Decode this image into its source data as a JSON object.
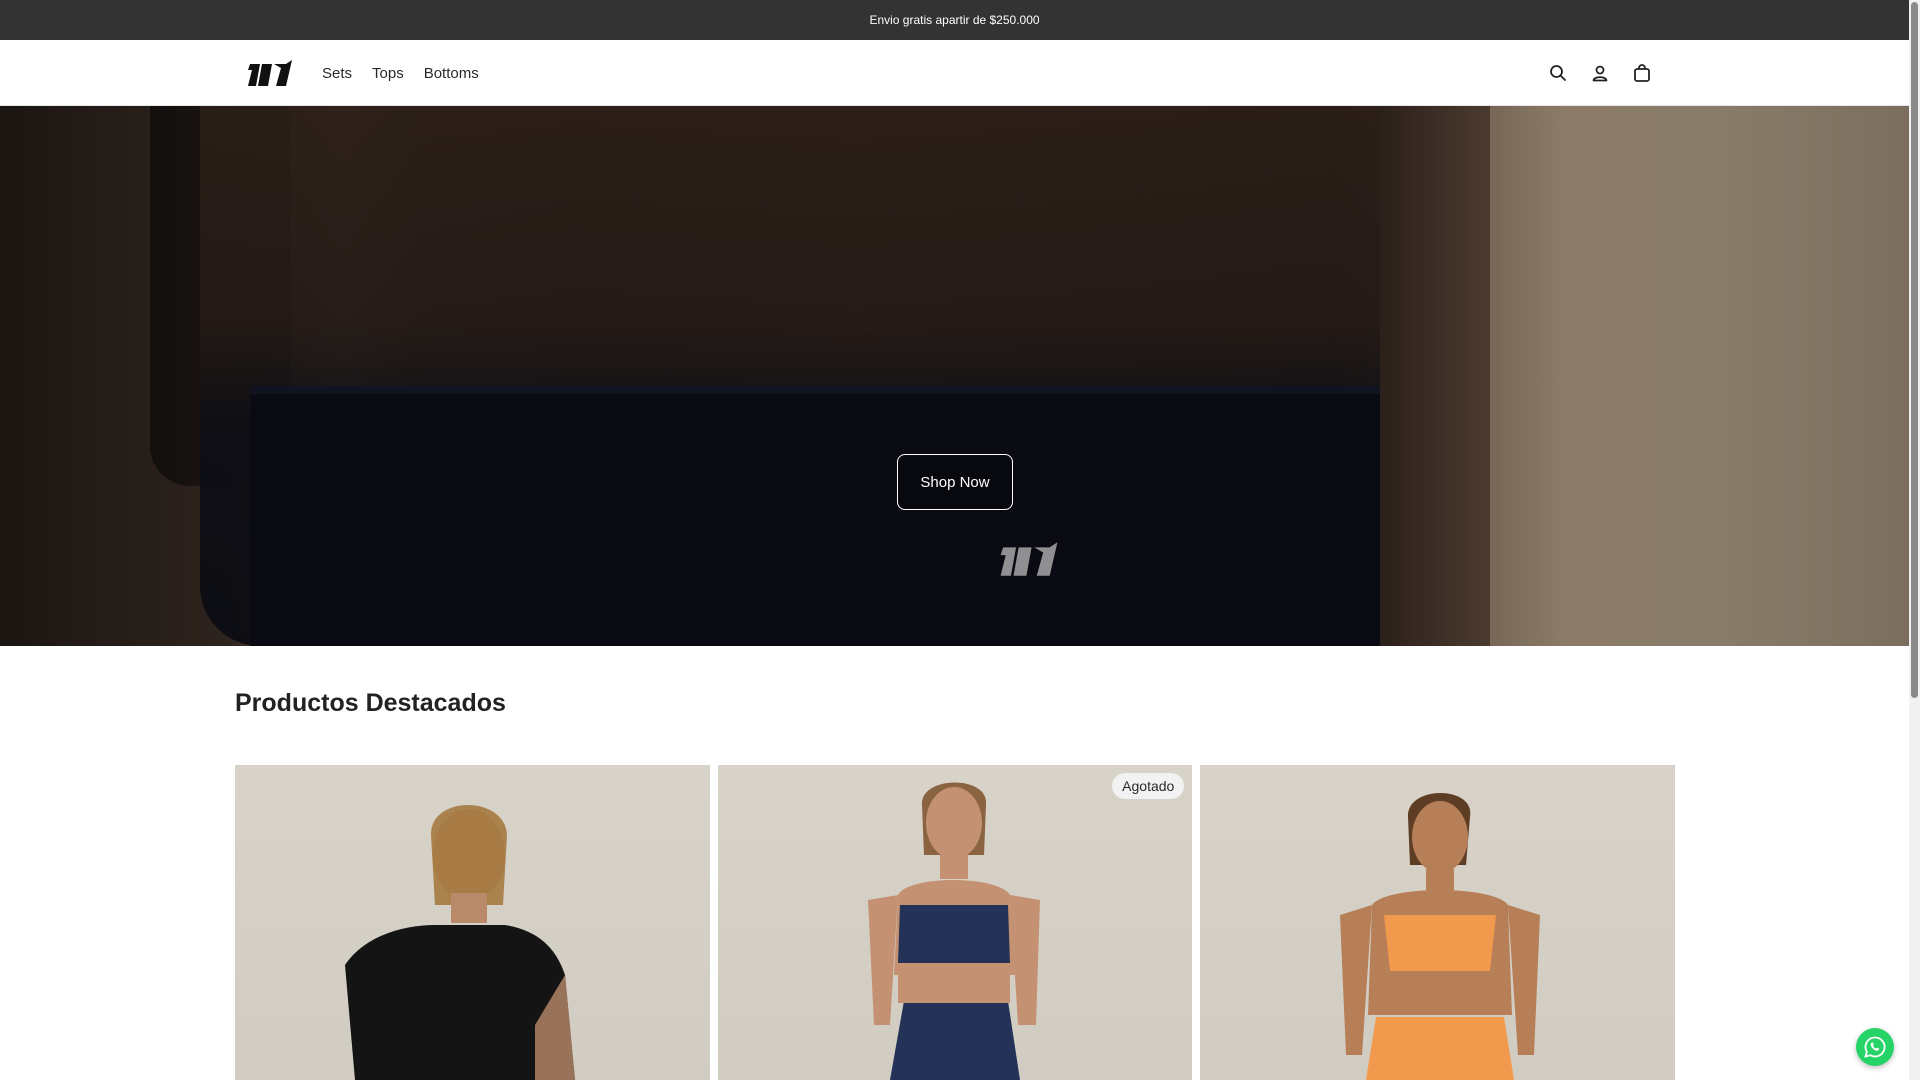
{
  "announcement": {
    "text": "Envio gratis apartir de $250.000"
  },
  "header": {
    "logo_alt": "logo",
    "nav": [
      {
        "label": "Sets"
      },
      {
        "label": "Tops"
      },
      {
        "label": "Bottoms"
      }
    ],
    "icons": [
      "search-icon",
      "account-icon",
      "bag-icon"
    ]
  },
  "hero": {
    "cta_label": "Shop Now"
  },
  "featured": {
    "title": "Productos Destacados",
    "products": [
      {
        "badge": ""
      },
      {
        "badge": "Agotado"
      },
      {
        "badge": ""
      }
    ]
  },
  "colors": {
    "announcement_bg": "#333333",
    "whatsapp": "#25d366",
    "product_bg": "#d5d0c6"
  }
}
